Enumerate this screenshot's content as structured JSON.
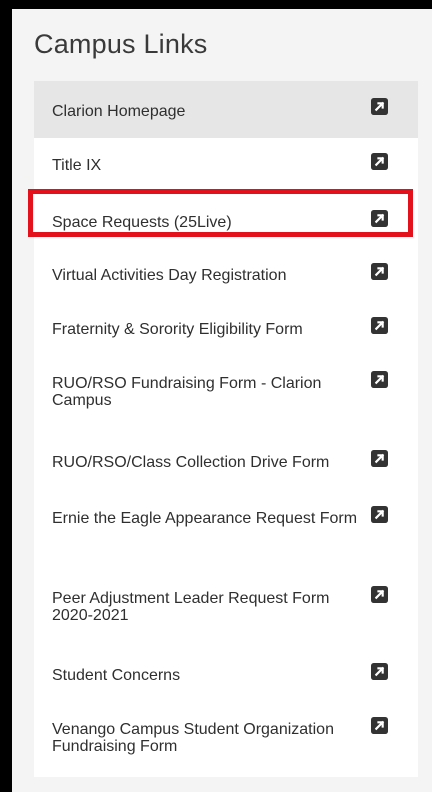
{
  "panel": {
    "title": "Campus Links"
  },
  "links": [
    {
      "label": "Clarion Homepage",
      "icon": "external-link-icon"
    },
    {
      "label": "Title IX",
      "icon": "external-link-icon"
    },
    {
      "label": "Space Requests (25Live)",
      "icon": "external-link-icon"
    },
    {
      "label": "Virtual Activities Day Registration",
      "icon": "external-link-icon"
    },
    {
      "label": "Fraternity & Sorority Eligibility Form",
      "icon": "external-link-icon"
    },
    {
      "label": "RUO/RSO Fundraising Form - Clarion Campus",
      "icon": "external-link-icon"
    },
    {
      "label": "RUO/RSO/Class Collection Drive Form",
      "icon": "external-link-icon"
    },
    {
      "label": "Ernie the Eagle Appearance Request Form",
      "icon": "external-link-icon"
    },
    {
      "label": "Peer Adjustment Leader Request Form 2020-2021",
      "icon": "external-link-icon"
    },
    {
      "label": "Student Concerns",
      "icon": "external-link-icon"
    },
    {
      "label": "Venango Campus Student Organization Fundraising Form",
      "icon": "external-link-icon"
    }
  ],
  "colors": {
    "highlight": "#e3111b",
    "icon": "#333333",
    "hover_row": "#e6e6e6"
  }
}
